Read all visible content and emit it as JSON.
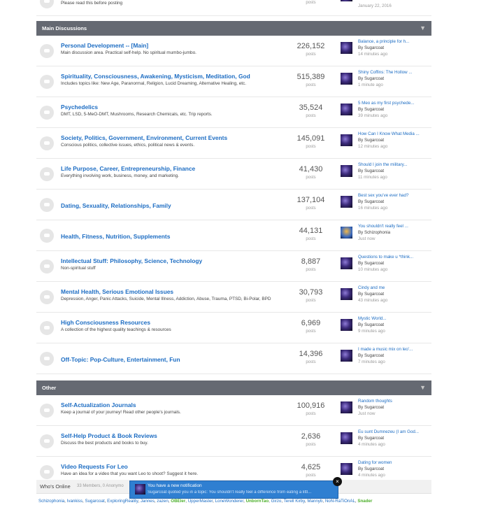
{
  "top_row": {
    "desc": "Please read this before posting",
    "stat_label": "posts",
    "time": "January 22, 2016"
  },
  "categories": [
    {
      "name": "Main Discussions",
      "forums": [
        {
          "title": "Personal Development -- [Main]",
          "desc": "Main discussion area. Practical self-help. No spiritual mumbo-jumbo.",
          "posts": "226,152",
          "posts_label": "posts",
          "last_title": "Balance, a principle for h...",
          "last_by": "By Sugarcoat",
          "last_time": "14 minutes ago"
        },
        {
          "title": "Spirituality, Consciousness, Awakening, Mysticism, Meditation, God",
          "desc": "Includes topics like: New Age, Paranormal, Religion, Lucid Dreaming, Alternative Healing, etc.",
          "posts": "515,389",
          "posts_label": "posts",
          "last_title": "Shiny Coffins: The Hollow ...",
          "last_by": "By Sugarcoat",
          "last_time": "1 minute ago"
        },
        {
          "title": "Psychedelics",
          "desc": "DMT, LSD, 5-MeO-DMT, Mushrooms, Research Chemicals, etc. Trip reports.",
          "posts": "35,524",
          "posts_label": "posts",
          "last_title": "5 Meo as my first psychede...",
          "last_by": "By Sugarcoat",
          "last_time": "39 minutes ago"
        },
        {
          "title": "Society, Politics, Government, Environment, Current Events",
          "desc": "Conscious politics, collective issues, ethics, political news & events.",
          "posts": "145,091",
          "posts_label": "posts",
          "last_title": "How Can I Know What Media ...",
          "last_by": "By Sugarcoat",
          "last_time": "12 minutes ago"
        },
        {
          "title": "Life Purpose, Career, Entrepreneurship, Finance",
          "desc": "Everything involving work, business, money, and marketing.",
          "posts": "41,430",
          "posts_label": "posts",
          "last_title": "Should I join the military...",
          "last_by": "By Sugarcoat",
          "last_time": "11 minutes ago"
        },
        {
          "title": "Dating, Sexuality, Relationships, Family",
          "desc": "",
          "posts": "137,104",
          "posts_label": "posts",
          "last_title": "Best sex you've ever had?",
          "last_by": "By Sugarcoat",
          "last_time": "16 minutes ago"
        },
        {
          "title": "Health, Fitness, Nutrition, Supplements",
          "desc": "",
          "posts": "44,131",
          "posts_label": "posts",
          "last_title": "You shouldn't really feel ...",
          "last_by": "By Schizophonia",
          "last_time": "Just now"
        },
        {
          "title": "Intellectual Stuff: Philosophy, Science, Technology",
          "desc": "Non-spiritual stuff",
          "posts": "8,887",
          "posts_label": "posts",
          "last_title": "Questions to make u *think...",
          "last_by": "By Sugarcoat",
          "last_time": "10 minutes ago"
        },
        {
          "title": "Mental Health, Serious Emotional Issues",
          "desc": "Depression, Anger, Panic Attacks, Suicide, Mental Illness, Addiction, Abuse, Trauma, PTSD, Bi-Polar, BPD",
          "posts": "30,793",
          "posts_label": "posts",
          "last_title": "Cindy and me",
          "last_by": "By Sugarcoat",
          "last_time": "43 minutes ago"
        },
        {
          "title": "High Consciousness Resources",
          "desc": "A collection of the highest quality teachings & resources",
          "posts": "6,969",
          "posts_label": "posts",
          "last_title": "Mystic World...",
          "last_by": "By Sugarcoat",
          "last_time": "9 minutes ago"
        },
        {
          "title": "Off-Topic: Pop-Culture, Entertainment, Fun",
          "desc": "",
          "posts": "14,396",
          "posts_label": "posts",
          "last_title": "I made a music mix on leo'...",
          "last_by": "By Sugarcoat",
          "last_time": "7 minutes ago"
        }
      ]
    },
    {
      "name": "Other",
      "forums": [
        {
          "title": "Self-Actualization Journals",
          "desc": "Keep a journal of your journey! Read other people's journals.",
          "posts": "100,916",
          "posts_label": "posts",
          "last_title": "Random thoughts",
          "last_by": "By Sugarcoat",
          "last_time": "Just now"
        },
        {
          "title": "Self-Help Product & Book Reviews",
          "desc": "Discuss the best products and books to buy.",
          "posts": "2,636",
          "posts_label": "posts",
          "last_title": "Eu sunt Dumnezeu (I am God...",
          "last_by": "By Sugarcoat",
          "last_time": "4 minutes ago"
        },
        {
          "title": "Video Requests For Leo",
          "desc": "Have an idea for a video that you want Leo to shoot? Suggest it here.",
          "posts": "4,625",
          "posts_label": "posts",
          "last_title": "Dating for women",
          "last_by": "By Sugarcoat",
          "last_time": "4 minutes ago"
        }
      ]
    }
  ],
  "whos_online": {
    "title": "Who's Online",
    "count": "33 Members, 0 Anonymo"
  },
  "members": [
    {
      "name": "Schizophonia",
      "highlight": false
    },
    {
      "name": "Ivankiss",
      "highlight": false
    },
    {
      "name": "Sugarcoat",
      "highlight": false
    },
    {
      "name": "ExploringReality",
      "highlight": false
    },
    {
      "name": "Jannes",
      "highlight": false
    },
    {
      "name": "zazen",
      "highlight": false
    },
    {
      "name": "OBEler",
      "highlight": true
    },
    {
      "name": "UpperMaster",
      "highlight": false
    },
    {
      "name": "LoneWonderer",
      "highlight": false
    },
    {
      "name": "UnbornTao",
      "highlight": true
    },
    {
      "name": "Girzo",
      "highlight": false
    },
    {
      "name": "Terell Kirby",
      "highlight": false
    },
    {
      "name": "Mannyb",
      "highlight": false
    },
    {
      "name": "NoN-RaTiOnAL",
      "highlight": false
    },
    {
      "name": "Snader",
      "highlight": true
    }
  ],
  "member_separator": ",",
  "notification": {
    "title": "You have a new notification",
    "body": "Sugarcoat quoted you in a topic: You shouldn't really feel a difference from eating a littl...",
    "close": "×"
  }
}
